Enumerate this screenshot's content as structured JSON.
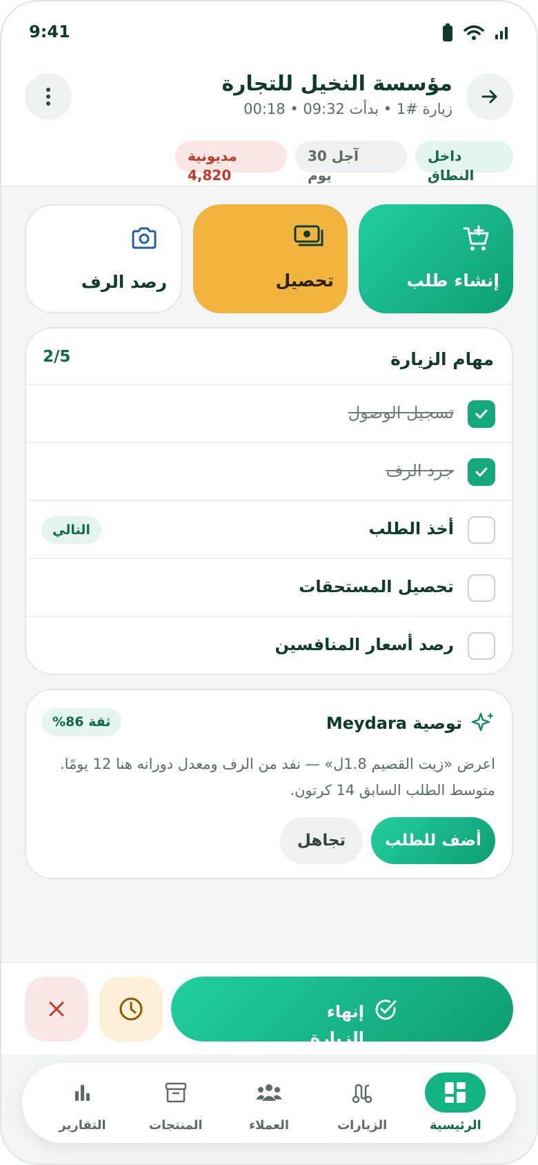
{
  "status_bar": {
    "time": "9:41"
  },
  "header": {
    "title": "مؤسسة النخيل للتجارة",
    "meta": "زيارة #1 • بدأت 09:32 • 00:18",
    "chips": [
      {
        "line1": "داخل",
        "line2": "النطاق"
      },
      {
        "line1": "آجل 30",
        "line2": "يوم"
      },
      {
        "line1": "مديونية",
        "line2": "4,820"
      }
    ]
  },
  "actions": {
    "create_order": "إنشاء طلب",
    "collect": "تحصيل",
    "shelf_audit": "رصد الرف"
  },
  "tasks": {
    "title": "مهام الزيارة",
    "count": "2/5",
    "next_badge": "التالي",
    "items": [
      {
        "label": "تسجيل الوصول",
        "done": true
      },
      {
        "label": "جرد الرف",
        "done": true
      },
      {
        "label": "أخذ الطلب",
        "done": false
      },
      {
        "label": "تحصيل المستحقات",
        "done": false
      },
      {
        "label": "رصد أسعار المنافسين",
        "done": false
      }
    ]
  },
  "recommendation": {
    "title": "توصية Meydara",
    "confidence": "ثقة 86%",
    "body": "اعرض «زيت القصيم 1.8ل» — نفد من الرف ومعدل دورانه هنا 12 يومًا. متوسط الطلب السابق 14 كرتون.",
    "add_label": "أضف للطلب",
    "ignore_label": "تجاهل"
  },
  "bottom_actions": {
    "finish_label": "إنهاء الزيارة"
  },
  "tabbar": {
    "home": "الرئيسية",
    "visits": "الزيارات",
    "customers": "العملاء",
    "products": "المنتجات",
    "reports": "التقارير"
  },
  "colors": {
    "brand_green": "#14a87a",
    "brand_dark": "#0f3b2c",
    "collect_yellow": "#f0b43f",
    "debt_red": "#c0392b"
  }
}
